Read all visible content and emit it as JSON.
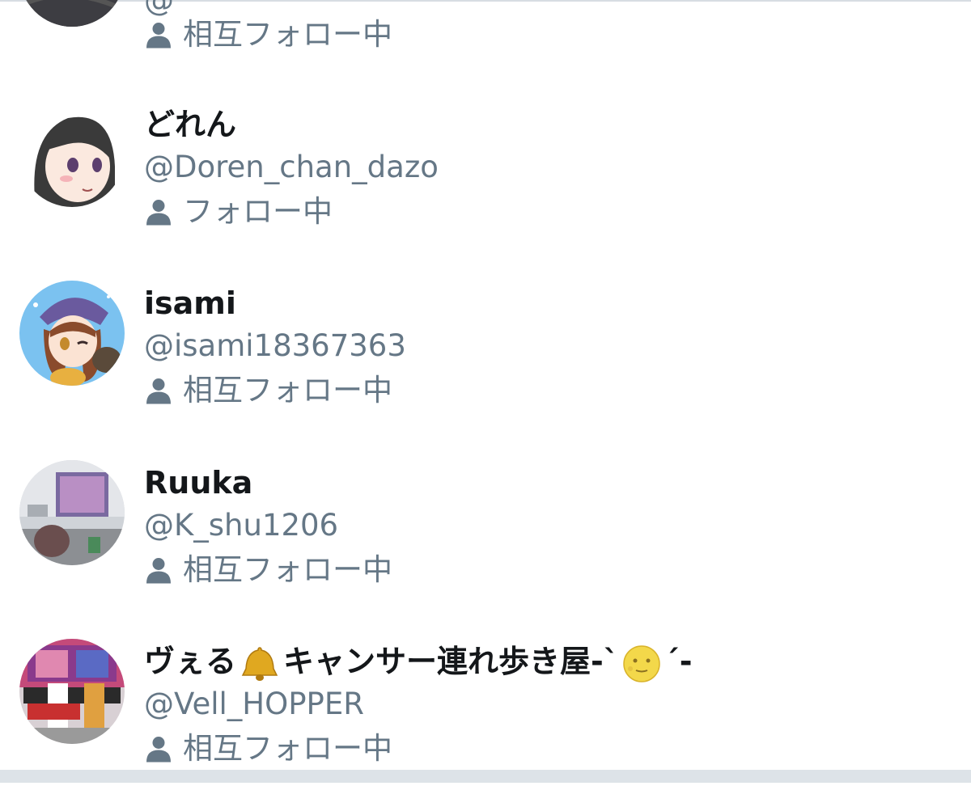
{
  "users": [
    {
      "name": "",
      "handle": "@",
      "status": "相互フォロー中"
    },
    {
      "name": "どれん",
      "handle": "@Doren_chan_dazo",
      "status": "フォロー中"
    },
    {
      "name": "isami",
      "handle": "@isami18367363",
      "status": "相互フォロー中"
    },
    {
      "name": "Ruuka",
      "handle": "@K_shu1206",
      "status": "相互フォロー中"
    },
    {
      "name_parts": [
        "ヴぇる",
        "キャンサー連れ歩き屋-ˋ",
        "ˊ-"
      ],
      "name_emojis": [
        "bell-emoji",
        "full-moon-face-emoji"
      ],
      "handle": "@Vell_HOPPER",
      "status": "相互フォロー中"
    }
  ],
  "colors": {
    "name": "#14171a",
    "secondary": "#657786",
    "background": "#ffffff"
  },
  "icons": {
    "status": "person-icon"
  }
}
